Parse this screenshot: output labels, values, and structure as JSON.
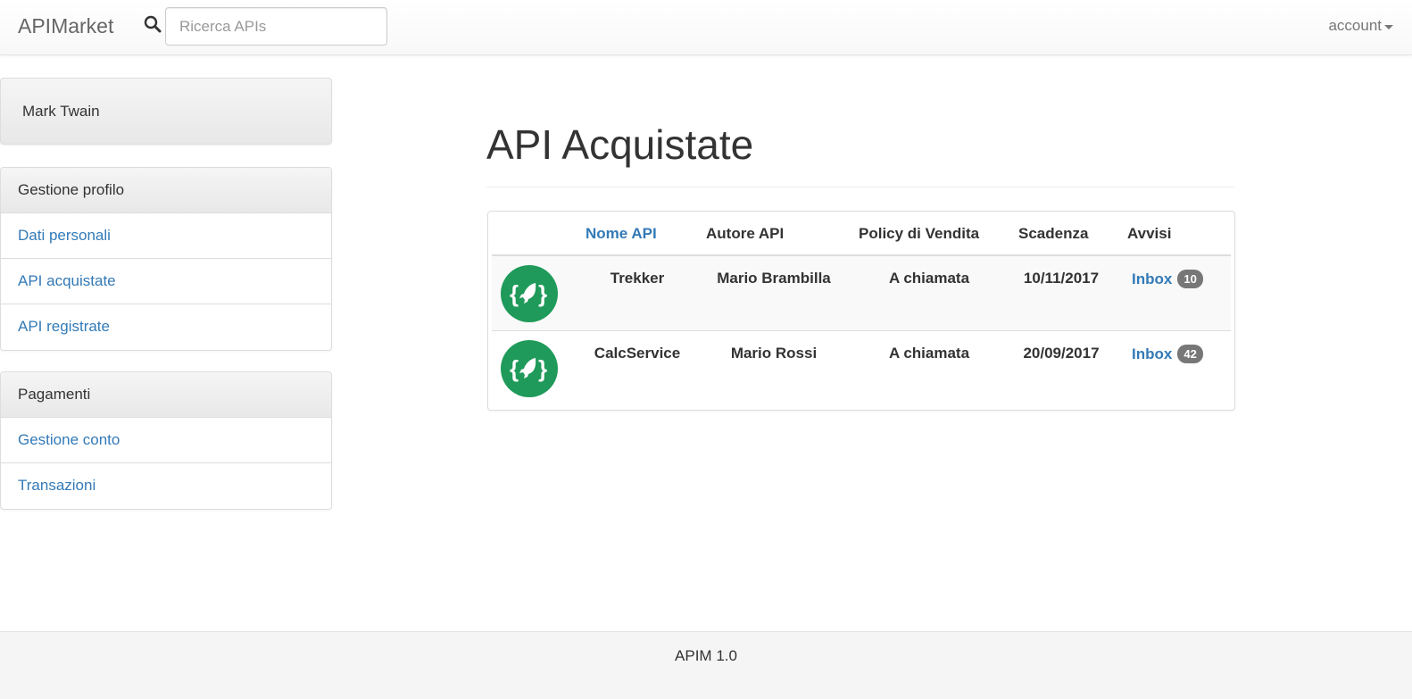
{
  "navbar": {
    "brand": "APIMarket",
    "search_icon": "search-icon",
    "search_placeholder": "Ricerca APIs",
    "account_label": "account"
  },
  "sidebar": {
    "user_name": "Mark Twain",
    "profile": {
      "heading": "Gestione profilo",
      "items": [
        {
          "label": "Dati personali"
        },
        {
          "label": "API acquistate"
        },
        {
          "label": "API registrate"
        }
      ]
    },
    "payments": {
      "heading": "Pagamenti",
      "items": [
        {
          "label": "Gestione conto"
        },
        {
          "label": "Transazioni"
        }
      ]
    }
  },
  "main": {
    "title": "API Acquistate",
    "table": {
      "headers": {
        "name": "Nome API",
        "author": "Autore API",
        "policy": "Policy di Vendita",
        "expiry": "Scadenza",
        "notices": "Avvisi"
      },
      "rows": [
        {
          "icon": "rocket-icon",
          "name": "Trekker",
          "author": "Mario Brambilla",
          "policy": "A chiamata",
          "expiry": "10/11/2017",
          "inbox_label": "Inbox",
          "inbox_count": "10"
        },
        {
          "icon": "rocket-icon",
          "name": "CalcService",
          "author": "Mario Rossi",
          "policy": "A chiamata",
          "expiry": "20/09/2017",
          "inbox_label": "Inbox",
          "inbox_count": "42"
        }
      ]
    }
  },
  "footer": {
    "text": "APIM 1.0"
  },
  "colors": {
    "link": "#337ab7",
    "logo_green": "#1f9a5a",
    "badge": "#777777"
  }
}
